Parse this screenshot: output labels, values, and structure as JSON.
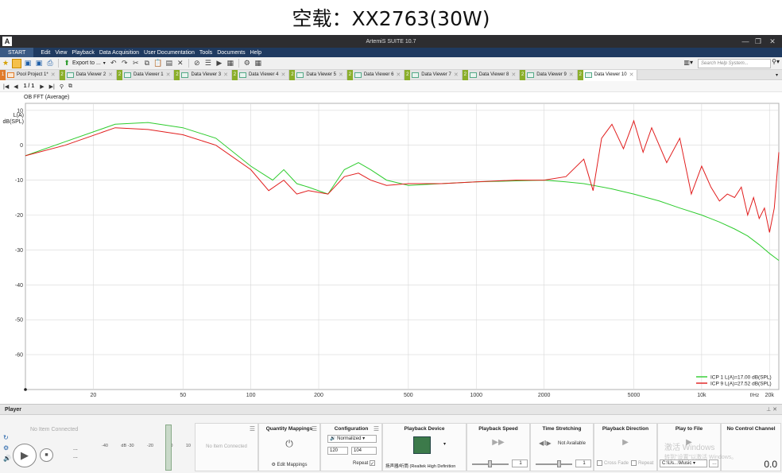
{
  "caption": "空载：XX2763(30W)",
  "window": {
    "title": "ArtemiS SUITE 10.7",
    "logo": "A"
  },
  "menu": {
    "start": "START",
    "items": [
      "Edit",
      "View",
      "Playback",
      "Data Acquisition",
      "User Documentation",
      "Tools",
      "Documents",
      "Help"
    ]
  },
  "toolbar": {
    "export_label": "Export to ...",
    "search_placeholder": "Search Help System..."
  },
  "tabs": [
    {
      "num": "1",
      "label": "Pool Project 1*",
      "color": "#e07b2a",
      "kind": "pool"
    },
    {
      "num": "2",
      "label": "Data Viewer 2",
      "color": "#8aae2a"
    },
    {
      "num": "2",
      "label": "Data Viewer 1",
      "color": "#8aae2a"
    },
    {
      "num": "2",
      "label": "Data Viewer 3",
      "color": "#8aae2a"
    },
    {
      "num": "2",
      "label": "Data Viewer 4",
      "color": "#8aae2a"
    },
    {
      "num": "2",
      "label": "Data Viewer 5",
      "color": "#8aae2a"
    },
    {
      "num": "2",
      "label": "Data Viewer 6",
      "color": "#8aae2a"
    },
    {
      "num": "2",
      "label": "Data Viewer 7",
      "color": "#8aae2a"
    },
    {
      "num": "2",
      "label": "Data Viewer 8",
      "color": "#8aae2a"
    },
    {
      "num": "2",
      "label": "Data Viewer 9",
      "color": "#8aae2a"
    },
    {
      "num": "2",
      "label": "Data Viewer 10",
      "color": "#8aae2a",
      "active": true
    }
  ],
  "nav": {
    "page": "1 / 1"
  },
  "chart_data": {
    "type": "line",
    "title": "OB FFT (Average)",
    "ylabel_line1": "L(A)",
    "ylabel_line2": "dB(SPL)",
    "xscale": "log",
    "xlim": [
      10,
      22000
    ],
    "ylim": [
      -70,
      12
    ],
    "y_ticks": [
      10,
      0,
      -10,
      -20,
      -30,
      -40,
      -50,
      -60
    ],
    "x_ticks": [
      {
        "v": 20,
        "label": "20"
      },
      {
        "v": 50,
        "label": "50"
      },
      {
        "v": 100,
        "label": "100"
      },
      {
        "v": 200,
        "label": "200"
      },
      {
        "v": 500,
        "label": "500"
      },
      {
        "v": 1000,
        "label": "1000"
      },
      {
        "v": 2000,
        "label": "2000"
      },
      {
        "v": 5000,
        "label": "5000"
      },
      {
        "v": 10000,
        "label": "10k"
      },
      {
        "v": 20000,
        "label": "20k"
      }
    ],
    "x_unit_label": "f/Hz",
    "grid": true,
    "legend_position": "bottom-right",
    "series": [
      {
        "name": "ICP 1 L(A)=17.00 dB(SPL)",
        "color": "#2ecc2e",
        "x": [
          10,
          15,
          25,
          35,
          50,
          70,
          100,
          125,
          140,
          160,
          180,
          220,
          260,
          300,
          340,
          400,
          500,
          700,
          1000,
          1500,
          2000,
          2500,
          3000,
          4000,
          5000,
          6500,
          8000,
          10000,
          12000,
          14000,
          16000,
          18000,
          20000,
          22000
        ],
        "y": [
          -3,
          1,
          6,
          6.5,
          5,
          2,
          -6,
          -10,
          -7,
          -11,
          -12,
          -14,
          -7,
          -5,
          -7,
          -10,
          -11.5,
          -11,
          -10.5,
          -10.2,
          -10,
          -10.5,
          -11,
          -12.5,
          -14,
          -16,
          -18,
          -20,
          -22,
          -24,
          -26,
          -28.5,
          -31,
          -33
        ]
      },
      {
        "name": "ICP 9 L(A)=27.52 dB(SPL)",
        "color": "#e11d1d",
        "x": [
          10,
          15,
          25,
          35,
          50,
          70,
          100,
          120,
          140,
          160,
          180,
          220,
          260,
          300,
          340,
          400,
          500,
          700,
          1000,
          1500,
          2000,
          2500,
          3000,
          3300,
          3600,
          4000,
          4500,
          5000,
          5500,
          6000,
          7000,
          8000,
          9000,
          10000,
          11000,
          12000,
          13000,
          14000,
          15000,
          16000,
          17000,
          18000,
          19000,
          20000,
          21000,
          22000
        ],
        "y": [
          -3,
          0,
          5,
          4.5,
          3,
          0,
          -7,
          -13,
          -10,
          -14,
          -13,
          -14,
          -9,
          -8,
          -10,
          -11.5,
          -11,
          -11,
          -10.5,
          -10,
          -10,
          -9,
          -4,
          -13,
          2,
          6,
          -1,
          7,
          -2,
          5,
          -5,
          2,
          -14,
          -6,
          -12,
          -16,
          -14,
          -15,
          -12,
          -20,
          -15,
          -21,
          -18,
          -25,
          -18,
          -2
        ]
      }
    ]
  },
  "player": {
    "title": "Player",
    "no_item": "No Item Connected",
    "dots": "...",
    "meter_ticks": [
      "-40",
      "dB -30",
      "-20",
      "-10",
      "10"
    ],
    "panels": {
      "no_item2": "No Item Connected",
      "quantity": {
        "title": "Quantity Mappings",
        "edit": "Edit Mappings"
      },
      "configuration": {
        "title": "Configuration",
        "mode": "Normalized",
        "a": "120",
        "b": "104",
        "repeat": "Repeat"
      },
      "device": {
        "title": "Playback Device",
        "name": "扬声器/听筒 (Realtek High Definition"
      },
      "speed": {
        "title": "Playback Speed",
        "value": "1"
      },
      "stretch": {
        "title": "Time Stretching",
        "status": "Not Available",
        "value": "1"
      },
      "direction": {
        "title": "Playback Direction",
        "cross": "Cross Fade",
        "repeat": "Repeat"
      },
      "file": {
        "title": "Play to File",
        "path": "C:\\Us...\\Music"
      },
      "channel": {
        "title": "No Control Channel",
        "value": "0.0"
      }
    },
    "watermark1": "激活 Windows",
    "watermark2": "转到\"设置\"以激活 Windows。"
  }
}
